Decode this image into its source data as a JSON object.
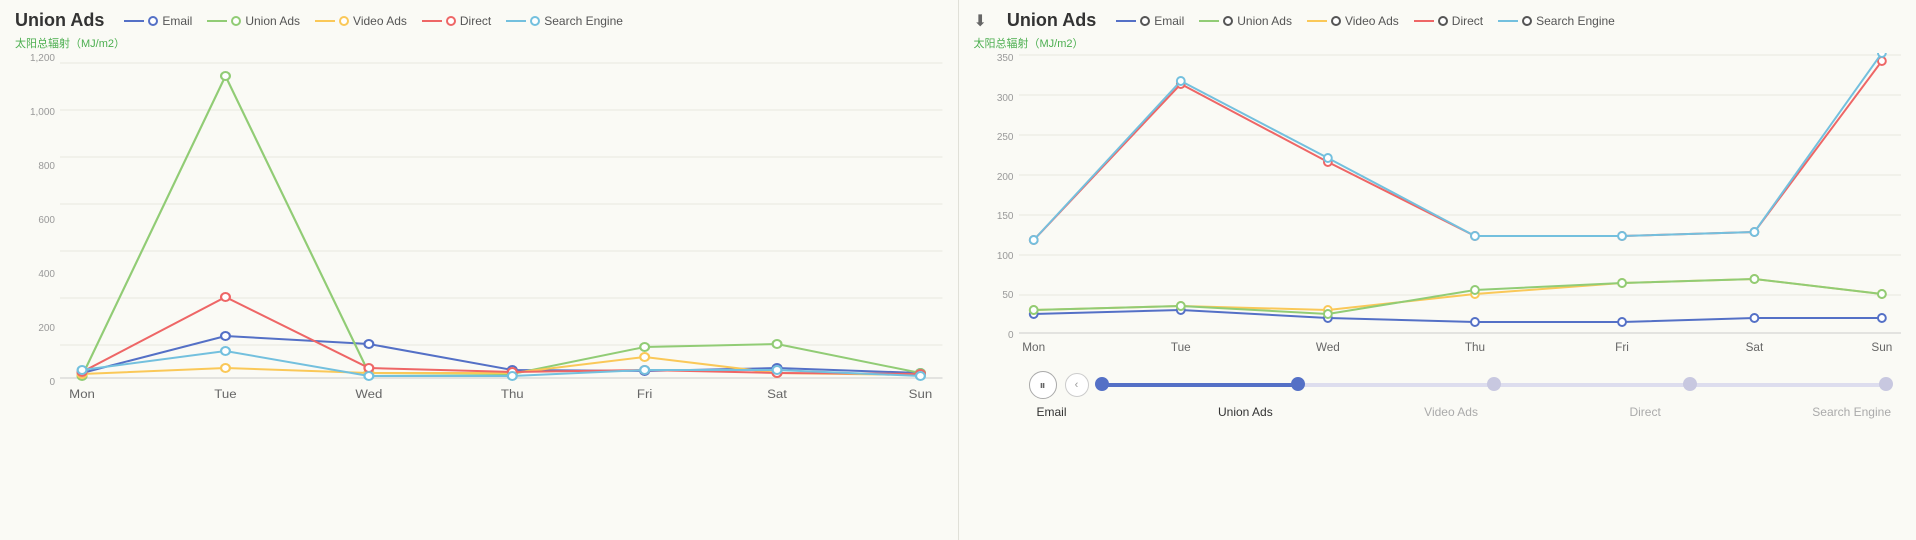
{
  "leftChart": {
    "title": "Union Ads",
    "axisLabel": "太阳总辐射（MJ/m2）",
    "yAxis": [
      "1,200",
      "1,000",
      "800",
      "600",
      "400",
      "200",
      "0"
    ],
    "xAxis": [
      "Mon",
      "Tue",
      "Wed",
      "Thu",
      "Fri",
      "Sat",
      "Sun"
    ],
    "legend": [
      {
        "name": "Email",
        "color": "#5470c6"
      },
      {
        "name": "Union Ads",
        "color": "#91cc75"
      },
      {
        "name": "Video Ads",
        "color": "#fac858"
      },
      {
        "name": "Direct",
        "color": "#ee6666"
      },
      {
        "name": "Search Engine",
        "color": "#73c0de"
      }
    ],
    "series": {
      "email": [
        20,
        160,
        130,
        30,
        25,
        40,
        20
      ],
      "unionAds": [
        10,
        1150,
        20,
        15,
        120,
        130,
        20
      ],
      "videoAds": [
        15,
        40,
        20,
        20,
        80,
        20,
        10
      ],
      "direct": [
        25,
        310,
        40,
        25,
        30,
        20,
        15
      ],
      "searchEngine": [
        30,
        80,
        10,
        10,
        30,
        30,
        10
      ]
    }
  },
  "rightChart": {
    "title": "Union Ads",
    "axisLabel": "太阳总辐射（MJ/m2）",
    "yAxis": [
      "350",
      "300",
      "250",
      "200",
      "150",
      "100",
      "50",
      "0"
    ],
    "xAxis": [
      "Mon",
      "Tue",
      "Wed",
      "Thu",
      "Fri",
      "Sat",
      "Sun"
    ],
    "legend": [
      {
        "name": "Email",
        "color": "#5470c6"
      },
      {
        "name": "Union Ads",
        "color": "#91cc75"
      },
      {
        "name": "Video Ads",
        "color": "#fac858"
      },
      {
        "name": "Direct",
        "color": "#ee6666"
      },
      {
        "name": "Search Engine",
        "color": "#73c0de"
      }
    ],
    "series": {
      "email": [
        25,
        30,
        20,
        15,
        15,
        20,
        20
      ],
      "unionAds": [
        30,
        35,
        25,
        55,
        65,
        70,
        50
      ],
      "videoAds": [
        30,
        35,
        30,
        50,
        65,
        70,
        50
      ],
      "direct": [
        120,
        320,
        220,
        125,
        125,
        130,
        350
      ],
      "searchEngine": [
        120,
        325,
        225,
        125,
        125,
        130,
        360
      ]
    }
  },
  "timeline": {
    "items": [
      "Email",
      "Union Ads",
      "Video Ads",
      "Direct",
      "Search Engine"
    ],
    "activeIndex": 1,
    "pauseLabel": "⏸",
    "prevLabel": "‹"
  }
}
